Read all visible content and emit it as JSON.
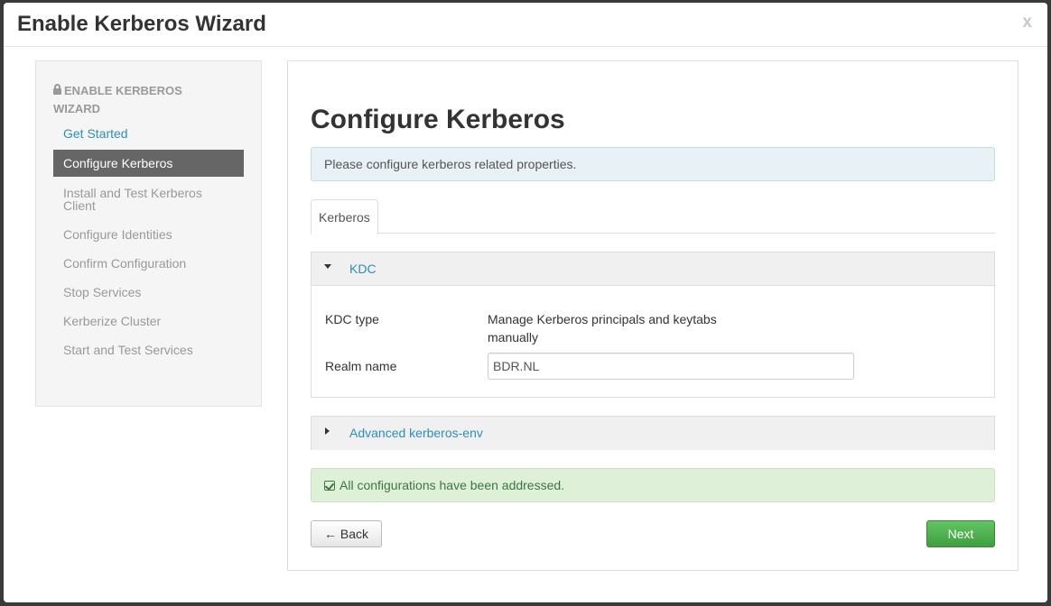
{
  "modal": {
    "title": "Enable Kerberos Wizard",
    "close_label": "x"
  },
  "sidebar": {
    "heading": "ENABLE KERBEROS WIZARD",
    "steps": [
      {
        "label": "Get Started",
        "state": "done"
      },
      {
        "label": "Configure Kerberos",
        "state": "active"
      },
      {
        "label": "Install and Test Kerberos Client",
        "state": "pending"
      },
      {
        "label": "Configure Identities",
        "state": "pending"
      },
      {
        "label": "Confirm Configuration",
        "state": "pending"
      },
      {
        "label": "Stop Services",
        "state": "pending"
      },
      {
        "label": "Kerberize Cluster",
        "state": "pending"
      },
      {
        "label": "Start and Test Services",
        "state": "pending"
      }
    ]
  },
  "main": {
    "title": "Configure Kerberos",
    "info_text": "Please configure kerberos related properties.",
    "tabs": [
      {
        "label": "Kerberos",
        "active": true
      }
    ],
    "kdc_section": {
      "title": "KDC",
      "expanded": true,
      "fields": [
        {
          "label": "KDC type",
          "value": "Manage Kerberos principals and keytabs manually"
        },
        {
          "label": "Realm name",
          "value": "BDR.NL"
        }
      ]
    },
    "advanced_section": {
      "title": "Advanced kerberos-env",
      "expanded": false
    },
    "success_text": "All configurations have been addressed.",
    "back_label": "← Back",
    "next_label": "Next →"
  },
  "colors": {
    "link": "#2a8fbd",
    "active_step_bg": "#666666",
    "success_bg": "#dff0d8",
    "info_bg": "#e8f1f6",
    "next_button": "#4cae4c"
  }
}
